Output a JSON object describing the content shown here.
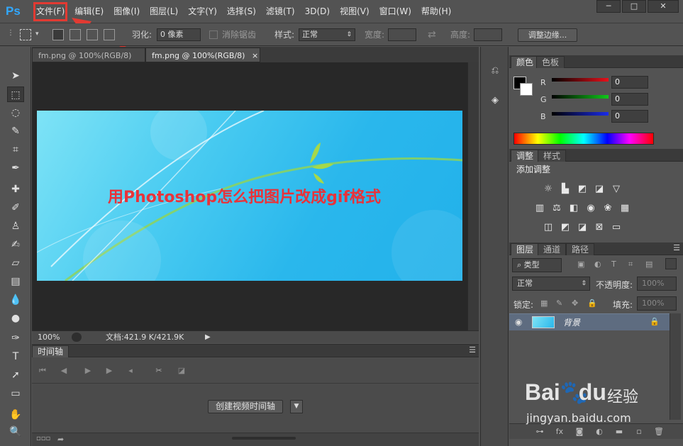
{
  "app": {
    "logo": "Ps"
  },
  "menu": {
    "items": [
      "文件(F)",
      "编辑(E)",
      "图像(I)",
      "图层(L)",
      "文字(Y)",
      "选择(S)",
      "滤镜(T)",
      "3D(D)",
      "视图(V)",
      "窗口(W)",
      "帮助(H)"
    ],
    "highlighted_index": 0
  },
  "window_controls": {
    "minimize": "─",
    "maximize": "□",
    "close": "✕"
  },
  "options": {
    "feather_label": "羽化:",
    "feather_value": "0 像素",
    "antialias_label": "消除锯齿",
    "style_label": "样式:",
    "style_value": "正常",
    "width_label": "宽度:",
    "height_label": "高度:",
    "refine_button": "调整边缘..."
  },
  "document": {
    "tabs": [
      {
        "label": "fm.png @ 100%(RGB/8)",
        "active": false
      },
      {
        "label": "fm.png @ 100%(RGB/8)",
        "active": true,
        "close": "×"
      }
    ],
    "image_title": "用Photoshop怎么把图片改成gif格式",
    "zoom": "100%",
    "doc_info": "文档:421.9 K/421.9K"
  },
  "timeline": {
    "tab": "时间轴",
    "create_button": "创建视频时间轴"
  },
  "color_panel": {
    "tabs": [
      "颜色",
      "色板"
    ],
    "channels": [
      {
        "label": "R",
        "value": "0",
        "color": "#e8101a"
      },
      {
        "label": "G",
        "value": "0",
        "color": "#10c81a"
      },
      {
        "label": "B",
        "value": "0",
        "color": "#1a2be8"
      }
    ]
  },
  "adjust_panel": {
    "tabs": [
      "调整",
      "样式"
    ],
    "title": "添加调整"
  },
  "layers_panel": {
    "tabs": [
      "图层",
      "通道",
      "路径"
    ],
    "filter_value": "类型",
    "blend_mode": "正常",
    "opacity_label": "不透明度:",
    "opacity_value": "100%",
    "lock_label": "锁定:",
    "fill_label": "填充:",
    "fill_value": "100%",
    "layer_name": "背景"
  },
  "watermark": {
    "logo_bai": "Bai",
    "logo_du": "du",
    "text": "经验",
    "url": "jingyan.baidu.com"
  }
}
